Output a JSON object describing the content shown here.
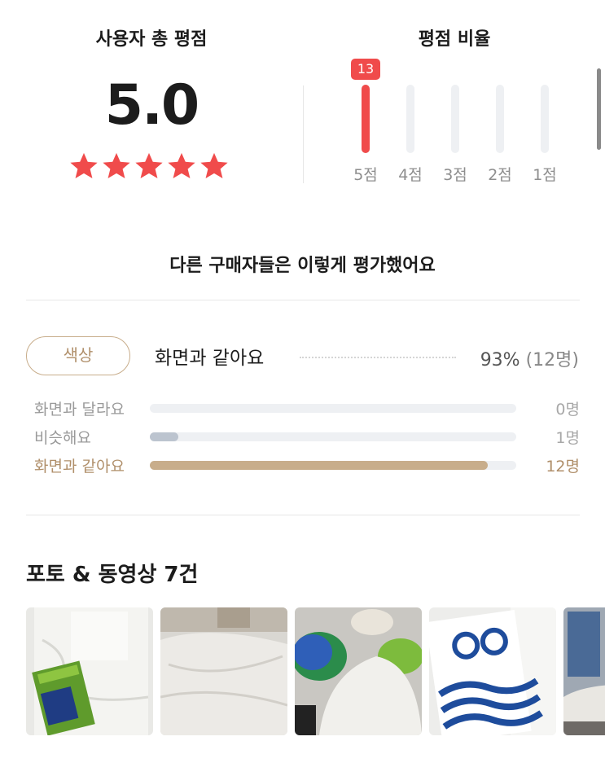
{
  "summary": {
    "total_title": "사용자 총 평점",
    "score": "5.0",
    "stars": 5,
    "ratio_title": "평점 비율"
  },
  "ratio": [
    {
      "label": "5점",
      "count": "13",
      "value": 13,
      "active": true
    },
    {
      "label": "4점",
      "value": 0,
      "active": false
    },
    {
      "label": "3점",
      "value": 0,
      "active": false
    },
    {
      "label": "2점",
      "value": 0,
      "active": false
    },
    {
      "label": "1점",
      "value": 0,
      "active": false
    }
  ],
  "others_title": "다른 구매자들은 이렇게 평가했어요",
  "attribute": {
    "name": "색상",
    "top_answer": "화면과 같아요",
    "percent": "93%",
    "people": "(12명)",
    "options": [
      {
        "label": "화면과 달라요",
        "count": "0명",
        "value": 0,
        "active": false
      },
      {
        "label": "비슷해요",
        "count": "1명",
        "value": 1,
        "active": false
      },
      {
        "label": "화면과 같아요",
        "count": "12명",
        "value": 12,
        "active": true
      }
    ]
  },
  "photos": {
    "title": "포토 & 동영상 7건"
  },
  "colors": {
    "star": "#f04b4b",
    "accent_beige": "#c8ad8b",
    "bar_gray": "#bcc4cf"
  }
}
